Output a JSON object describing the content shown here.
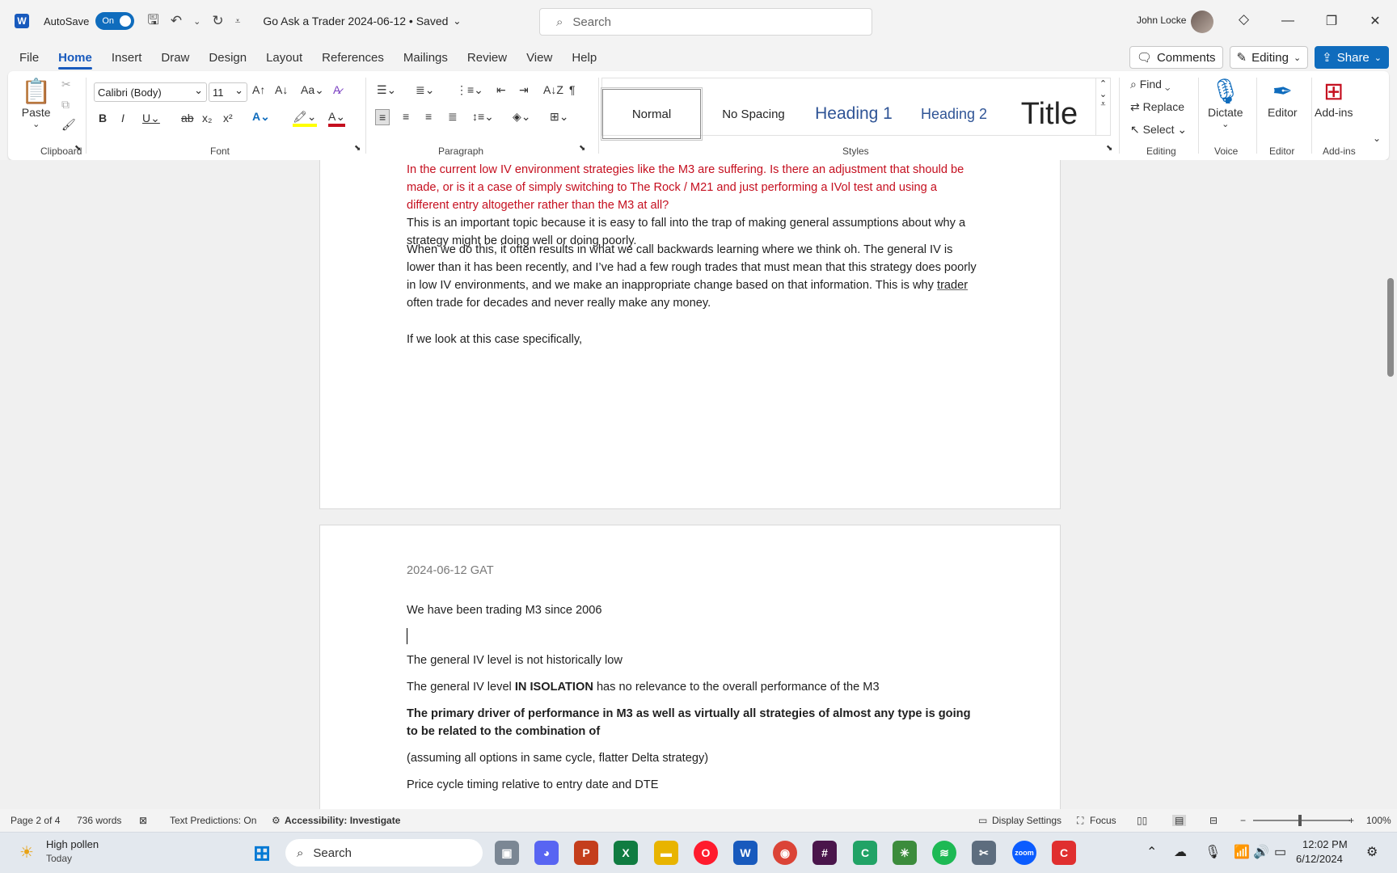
{
  "titlebar": {
    "autosave_label": "AutoSave",
    "autosave_state": "On",
    "doc_title": "Go Ask a Trader 2024-06-12 • Saved",
    "search_placeholder": "Search",
    "user_name": "John Locke"
  },
  "tabs": [
    "File",
    "Home",
    "Insert",
    "Draw",
    "Design",
    "Layout",
    "References",
    "Mailings",
    "Review",
    "View",
    "Help"
  ],
  "tab_right": {
    "comments": "Comments",
    "editing": "Editing",
    "share": "Share"
  },
  "ribbon": {
    "clipboard": {
      "paste": "Paste",
      "label": "Clipboard"
    },
    "font": {
      "name": "Calibri (Body)",
      "size": "11",
      "label": "Font"
    },
    "paragraph": {
      "label": "Paragraph"
    },
    "styles": {
      "normal": "Normal",
      "no_spacing": "No Spacing",
      "heading1": "Heading 1",
      "heading2": "Heading 2",
      "title": "Title",
      "label": "Styles"
    },
    "editing": {
      "find": "Find",
      "replace": "Replace",
      "select": "Select",
      "label": "Editing"
    },
    "voice": {
      "dictate": "Dictate",
      "label": "Voice"
    },
    "editor": {
      "editor": "Editor",
      "label": "Editor"
    },
    "addins": {
      "addins": "Add-ins",
      "label": "Add-ins"
    }
  },
  "document": {
    "page1": {
      "question": "In the current low IV environment strategies like the M3 are suffering. Is there an adjustment that should be made, or is it a case of simply switching to The Rock / M21 and just performing a IVol test and using a different entry altogether rather than the M3 at all?",
      "para1": "This is an important topic because it is easy to fall into the trap of making general assumptions about why a strategy might be doing well or doing poorly.",
      "para2_a": "When we do this, it often results in what we call backwards learning where we think oh. The general IV is lower than it has been recently, and I’ve had a few rough trades that must mean that this strategy does poorly in low IV environments, and we make an inappropriate change based on that information. This is why ",
      "para2_link": "trader",
      "para2_b": " often trade for decades and never really make any money.",
      "para3": "If we look at this case specifically,"
    },
    "page2": {
      "header": "2024-06-12 GAT",
      "line1": "We have been trading M3 since 2006",
      "line2": "The general IV level is not historically low",
      "line3_a": "The general IV level ",
      "line3_b": "IN ISOLATION",
      "line3_c": " has no relevance to the overall performance of the M3",
      "line4": "The primary driver of performance in M3 as well as virtually all strategies of almost any type is going to be related to the combination of",
      "line5": "(assuming all options in same cycle, flatter Delta strategy)",
      "line6": "Price cycle timing relative to entry date and DTE"
    }
  },
  "statusbar": {
    "page": "Page 2 of 4",
    "words": "736 words",
    "text_predictions": "Text Predictions: On",
    "accessibility": "Accessibility: Investigate",
    "display_settings": "Display Settings",
    "focus": "Focus",
    "zoom": "100%"
  },
  "taskbar": {
    "weather_title": "High pollen",
    "weather_sub": "Today",
    "search": "Search",
    "time": "12:02 PM",
    "date": "6/12/2024"
  },
  "colors": {
    "accent": "#0f6cbd",
    "word_blue": "#185abd",
    "question_red": "#c50f1f"
  }
}
